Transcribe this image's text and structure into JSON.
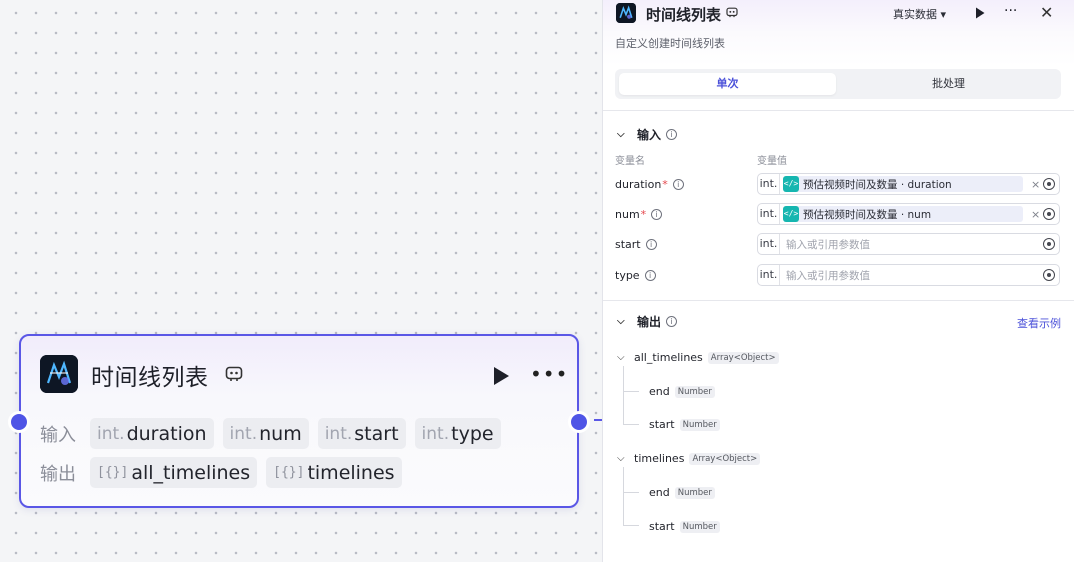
{
  "node": {
    "title": "时间线列表",
    "input_label": "输入",
    "output_label": "输出",
    "inputs": [
      {
        "type": "int.",
        "name": "duration"
      },
      {
        "type": "int.",
        "name": "num"
      },
      {
        "type": "int.",
        "name": "start"
      },
      {
        "type": "int.",
        "name": "type"
      }
    ],
    "outputs": [
      {
        "type": "[{}]",
        "name": "all_timelines"
      },
      {
        "type": "[{}]",
        "name": "timelines"
      }
    ]
  },
  "panel": {
    "title": "时间线列表",
    "data_mode": "真实数据 ▾",
    "description": "自定义创建时间线列表",
    "tabs": [
      "单次",
      "批处理"
    ],
    "input_section": "输入",
    "col_var_name": "变量名",
    "col_var_value": "变量值",
    "inputs": [
      {
        "name": "duration",
        "required": "*",
        "type": "int.",
        "ref": "预估视频时间及数量 · duration"
      },
      {
        "name": "num",
        "required": "*",
        "type": "int.",
        "ref": "预估视频时间及数量 · num"
      },
      {
        "name": "start",
        "type": "int.",
        "placeholder": "输入或引用参数值"
      },
      {
        "name": "type",
        "type": "int.",
        "placeholder": "输入或引用参数值"
      }
    ],
    "output_section": "输出",
    "see_example": "查看示例",
    "outputs": [
      {
        "name": "all_timelines",
        "type": "Array<Object>",
        "children": [
          {
            "name": "end",
            "type": "Number"
          },
          {
            "name": "start",
            "type": "Number"
          }
        ]
      },
      {
        "name": "timelines",
        "type": "Array<Object>",
        "children": [
          {
            "name": "end",
            "type": "Number"
          },
          {
            "name": "start",
            "type": "Number"
          }
        ]
      }
    ]
  },
  "colors": {
    "accent": "#5a57e6",
    "port": "#4f55e6",
    "link": "#4b51d9",
    "ref_icon": "#16b6b0"
  },
  "icons": [
    "logo-icon",
    "badge-icon",
    "play-icon",
    "more-icon",
    "close-icon",
    "info-icon",
    "chevron-down-icon",
    "code-ref-icon",
    "clear-icon",
    "target-icon"
  ]
}
